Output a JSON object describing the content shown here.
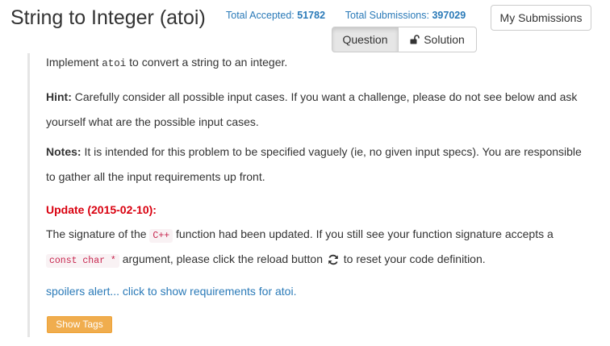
{
  "header": {
    "title": "String to Integer (atoi)",
    "accepted_label": "Total Accepted:",
    "accepted_value": "51782",
    "submissions_label": "Total Submissions:",
    "submissions_value": "397029",
    "my_submissions": "My Submissions"
  },
  "tabs": {
    "question": "Question",
    "solution": "Solution"
  },
  "description": {
    "p1_before": "Implement",
    "p1_code": "atoi",
    "p1_after": "to convert a string to an integer.",
    "hint_label": "Hint:",
    "hint_line1": "Carefully consider all possible input cases. If you want a challenge, please do not see below and ask",
    "hint_line2": "yourself what are the possible input cases.",
    "notes_label": "Notes:",
    "notes_line1": "It is intended for this problem to be specified vaguely (ie, no given input specs). You are responsible",
    "notes_line2": "to gather all the input requirements up front.",
    "update_label": "Update (2015-02-10):",
    "update_line1_before": "The signature of the",
    "update_line1_code": "C++",
    "update_line1_after": "function had been updated. If you still see your function signature accepts a",
    "update_line2_code": "const char *",
    "update_line2_mid": "argument, please click the reload button",
    "update_line2_after": "to reset your code definition.",
    "spoiler": "spoilers alert... click to show requirements for atoi.",
    "show_tags": "Show Tags"
  }
}
